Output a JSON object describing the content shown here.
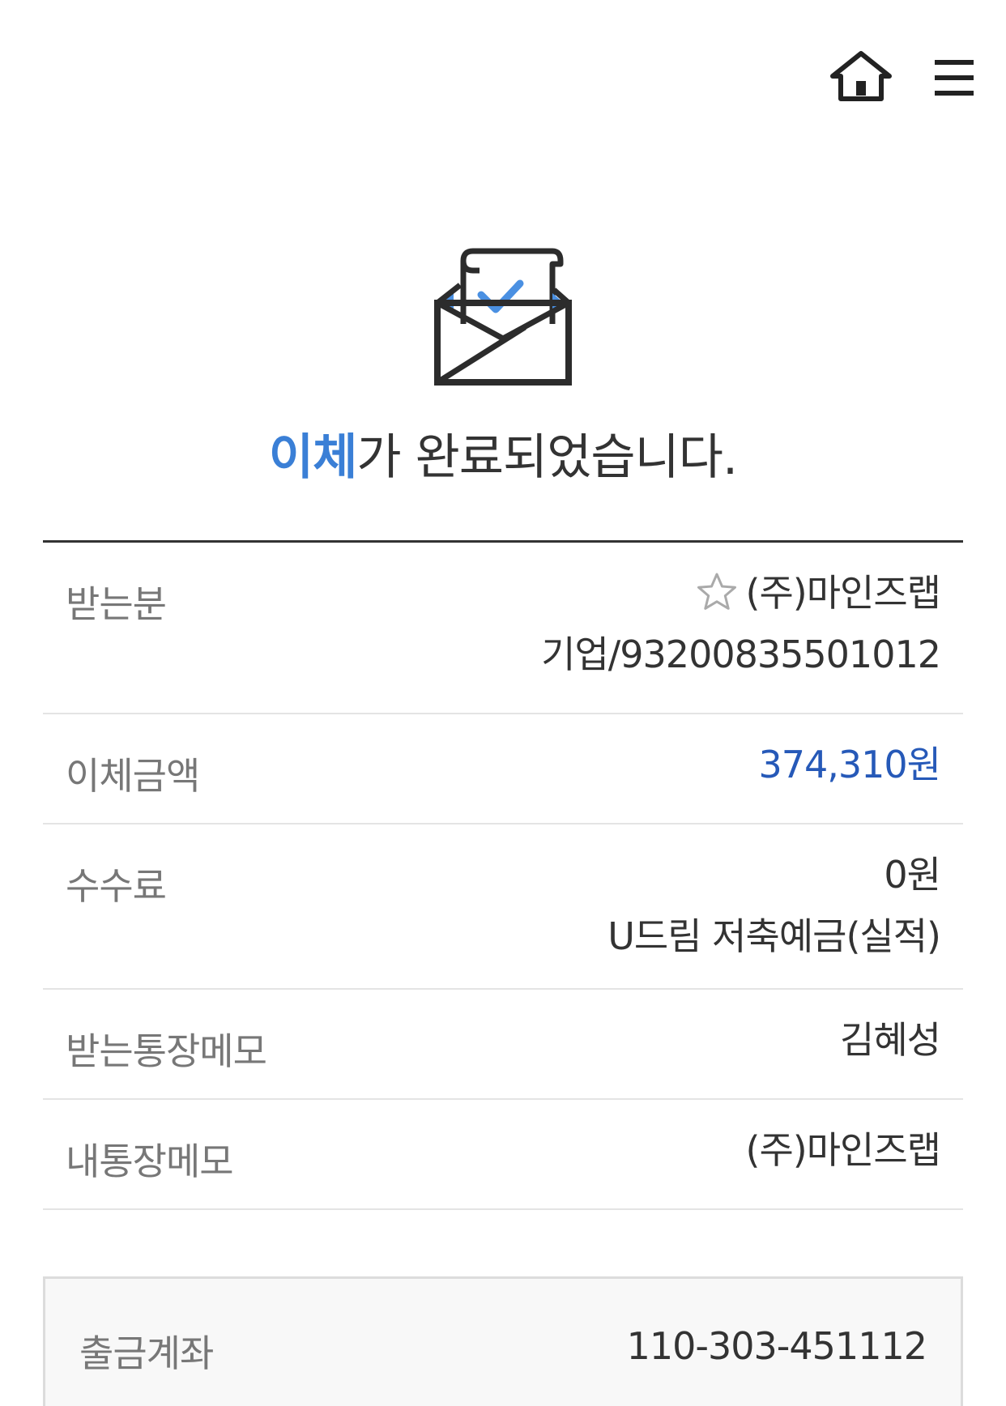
{
  "header": {
    "home_icon": "home-icon",
    "menu_icon": "hamburger-menu-icon"
  },
  "hero": {
    "icon": "envelope-check-icon",
    "title_accent": "이체",
    "title_rest": "가 완료되었습니다."
  },
  "details": {
    "recipient": {
      "label": "받는분",
      "name": "(주)마인즈랩",
      "account": "기업/93200835501012",
      "favorite_icon": "star-outline-icon"
    },
    "amount": {
      "label": "이체금액",
      "value": "374,310원"
    },
    "fee": {
      "label": "수수료",
      "value": "0원",
      "note": "U드림 저축예금(실적)"
    },
    "recipient_memo": {
      "label": "받는통장메모",
      "value": "김혜성"
    },
    "my_memo": {
      "label": "내통장메모",
      "value": "(주)마인즈랩"
    }
  },
  "withdrawal": {
    "label": "출금계좌",
    "value": "110-303-451112"
  },
  "colors": {
    "accent": "#3a7fd6",
    "amount": "#2659b8",
    "text": "#333333",
    "label": "#777777"
  }
}
